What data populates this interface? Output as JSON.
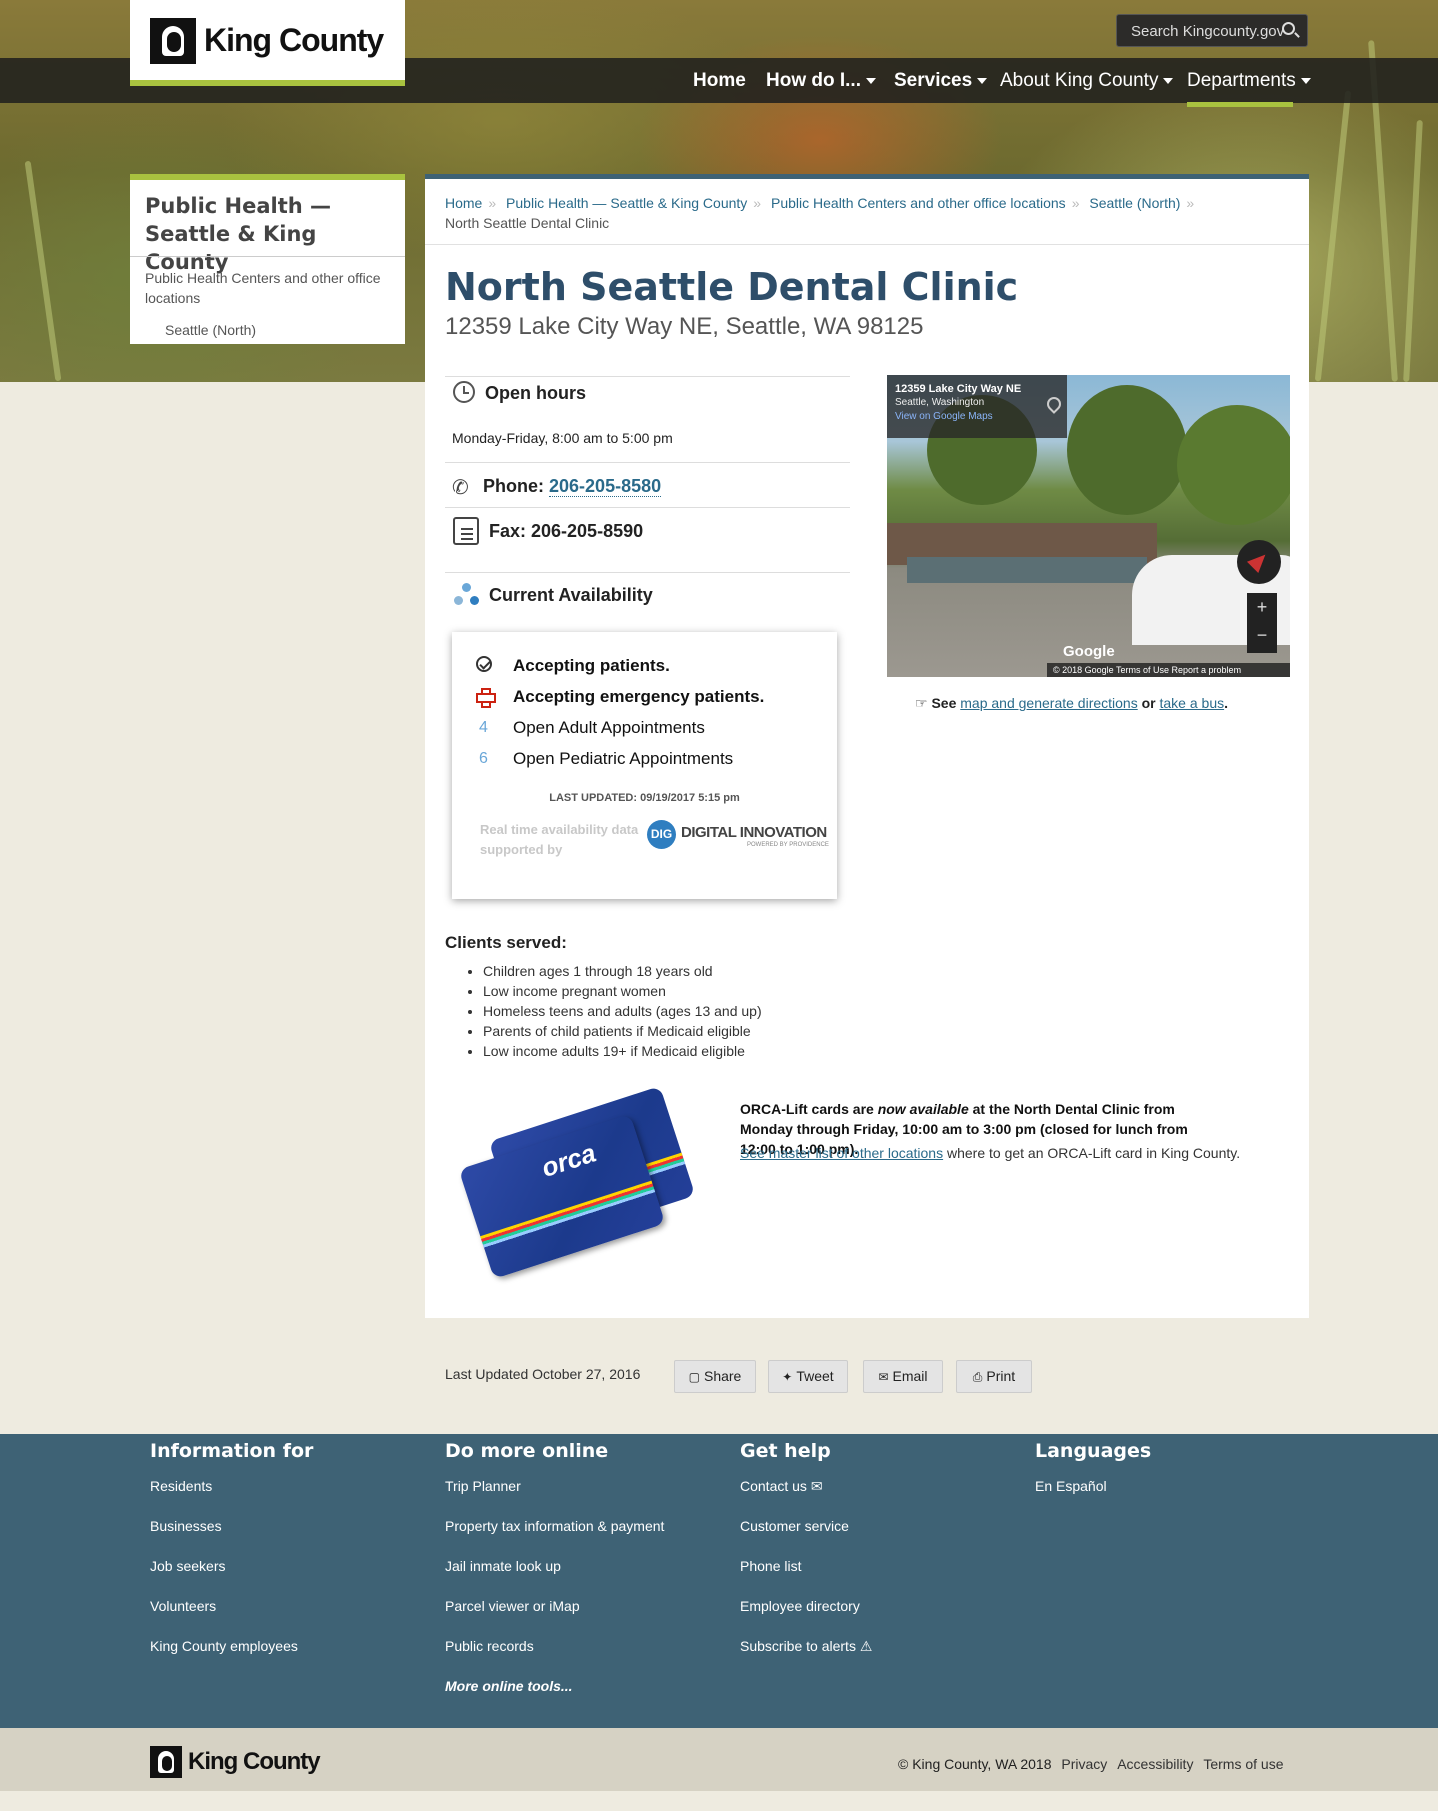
{
  "header": {
    "logo_text": "King County",
    "search_placeholder": "Search Kingcounty.gov",
    "nav": [
      {
        "label": "Home"
      },
      {
        "label": "How do I..."
      },
      {
        "label": "Services"
      },
      {
        "label": "About King County"
      },
      {
        "label": "Departments"
      }
    ]
  },
  "sidebar": {
    "title": "Public Health — Seattle & King County",
    "items": [
      {
        "label": "Public Health Centers and other office locations"
      },
      {
        "label": "Seattle (North)"
      }
    ]
  },
  "breadcrumb": {
    "items": [
      "Home",
      "Public Health — Seattle & King County",
      "Public Health Centers and other office locations",
      "Seattle (North)"
    ],
    "current": "North Seattle Dental Clinic"
  },
  "page": {
    "title": "North Seattle Dental Clinic",
    "address": "12359 Lake City Way NE, Seattle, WA 98125",
    "open_hours_label": "Open hours",
    "open_hours": "Monday-Friday, 8:00 am to 5:00 pm",
    "phone_label": "Phone:",
    "phone": "206-205-8580",
    "fax": "Fax: 206-205-8590",
    "availability_label": "Current Availability"
  },
  "availability": {
    "accepting": "Accepting patients.",
    "emergency": "Accepting emergency patients.",
    "adult_count": "4",
    "adult_label": "Open Adult Appointments",
    "pediatric_count": "6",
    "pediatric_label": "Open Pediatric Appointments",
    "last_updated": "LAST UPDATED:  09/19/2017 5:15 pm",
    "supported_by": "Real time availability data supported by",
    "dig_badge": "DIG",
    "dig_name": "DIGITAL INNOVATION",
    "dig_powered": "POWERED BY PROVIDENCE"
  },
  "map": {
    "street": "12359 Lake City Way NE",
    "city": "Seattle, Washington",
    "view_link": "View on Google Maps",
    "google": "Google",
    "attribution": "© 2018 Google   Terms of Use   Report a problem",
    "zoom_in": "+",
    "zoom_out": "−"
  },
  "directions": {
    "see": "See",
    "map_link": "map and generate directions",
    "or": "or",
    "bus_link": "take a bus",
    "end": "."
  },
  "clients": {
    "heading": "Clients served:",
    "items": [
      "Children ages 1 through 18 years old",
      "Low income pregnant women",
      "Homeless teens and adults (ages 13 and up)",
      "Parents of child patients if Medicaid eligible",
      "Low income adults 19+ if Medicaid eligible"
    ]
  },
  "orca": {
    "card_logo": "orca",
    "text_a": "ORCA-Lift cards are ",
    "text_em": "now available",
    "text_b": " at the North Dental Clinic from Monday through Friday, 10:00 am to 3:00 pm (closed for lunch from 12:00 to 1:00 pm).",
    "link": "See master list of other locations",
    "link_tail": " where to get an ORCA-Lift card in King County."
  },
  "meta": {
    "last_updated": "Last Updated October 27, 2016",
    "share": "Share",
    "tweet": "Tweet",
    "email": "Email",
    "print": "Print"
  },
  "footer": {
    "columns": [
      {
        "title": "Information for",
        "links": [
          "Residents",
          "Businesses",
          "Job seekers",
          "Volunteers",
          "King County employees"
        ]
      },
      {
        "title": "Do more online",
        "links": [
          "Trip Planner",
          "Property tax information & payment",
          "Jail inmate look up",
          "Parcel viewer or iMap",
          "Public records",
          "More online tools..."
        ]
      },
      {
        "title": "Get help",
        "links": [
          "Contact us ✉",
          "Customer service",
          "Phone list",
          "Employee directory",
          "Subscribe to alerts ⚠"
        ]
      },
      {
        "title": "Languages",
        "links": [
          "En Español"
        ]
      }
    ],
    "logo_text": "King County",
    "copyright": "© King County, WA 2018",
    "privacy": "Privacy",
    "accessibility": "Accessibility",
    "terms": "Terms of use"
  },
  "colors": {
    "accent_green": "#a9c23f",
    "footer_blue": "#3e6275",
    "title_blue": "#2e4e6a",
    "link_blue": "#2a6a8a"
  }
}
